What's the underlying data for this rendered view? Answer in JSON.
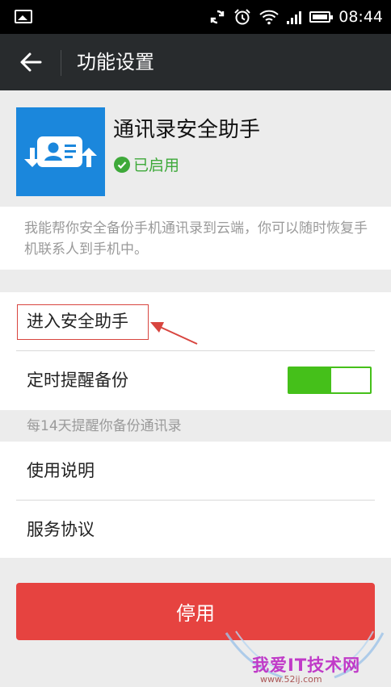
{
  "status_bar": {
    "time": "08:44",
    "icons": [
      "image-notification-icon",
      "sync-icon",
      "alarm-icon",
      "wifi-icon",
      "signal-icon",
      "battery-icon"
    ]
  },
  "header": {
    "title": "功能设置",
    "back_icon": "arrow-left-icon"
  },
  "app": {
    "name": "通讯录安全助手",
    "status": "已启用",
    "icon": "contact-card-sync-icon",
    "description": "我能帮你安全备份手机通讯录到云端，你可以随时恢复手机联系人到手机中。"
  },
  "settings": {
    "enter_assistant": "进入安全助手",
    "scheduled_reminder": "定时提醒备份",
    "scheduled_reminder_enabled": true,
    "reminder_hint": "每14天提醒你备份通讯录"
  },
  "links": {
    "instructions": "使用说明",
    "service_agreement": "服务协议"
  },
  "footer": {
    "disable_label": "停用"
  },
  "watermark": {
    "text": "我爱IT技术网",
    "url": "www.52ij.com"
  },
  "colors": {
    "status_bar": "#000000",
    "title_bar": "#282b2d",
    "app_icon": "#1b87dc",
    "enabled_green": "#3ea93a",
    "toggle_green": "#45c01a",
    "danger_red": "#e64340",
    "annotation_red": "#d8453f"
  }
}
